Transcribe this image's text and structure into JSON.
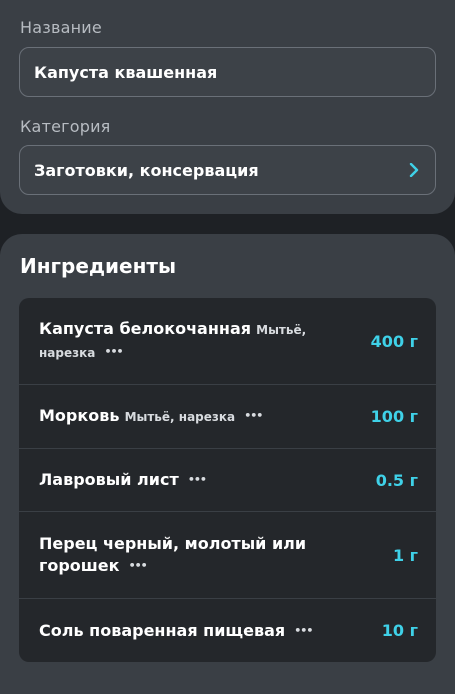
{
  "form": {
    "name_label": "Название",
    "name_value": "Капуста квашенная",
    "category_label": "Категория",
    "category_value": "Заготовки, консервация"
  },
  "ingredients": {
    "title": "Ингредиенты",
    "items": [
      {
        "name": "Капуста белокочанная",
        "note": "Мытьё, нарезка",
        "more": "•••",
        "qty": "400 г"
      },
      {
        "name": "Морковь",
        "note": "Мытьё, нарезка",
        "more": "•••",
        "qty": "100 г"
      },
      {
        "name": "Лавровый лист",
        "note": "",
        "more": "•••",
        "qty": "0.5 г"
      },
      {
        "name": "Перец черный, молотый или горошек",
        "note": "",
        "more": "•••",
        "qty": "1 г"
      },
      {
        "name": "Соль поваренная пищевая",
        "note": "",
        "more": "•••",
        "qty": "10 г"
      }
    ]
  },
  "colors": {
    "accent": "#3fd1e8",
    "card": "#3a3f45",
    "list": "#24272b",
    "background": "#1e2125"
  }
}
